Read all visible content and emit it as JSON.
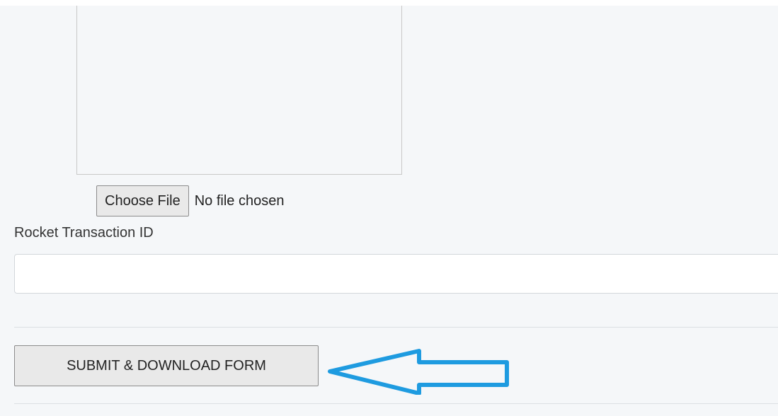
{
  "upload": {
    "choose_label": "Choose File",
    "status": "No file chosen"
  },
  "rocket_field": {
    "label": "Rocket Transaction ID",
    "value": "",
    "placeholder": ""
  },
  "submit": {
    "label": "SUBMIT & DOWNLOAD FORM"
  },
  "annotation": {
    "icon": "arrow-left-outline-icon",
    "color": "#1e9be0"
  }
}
